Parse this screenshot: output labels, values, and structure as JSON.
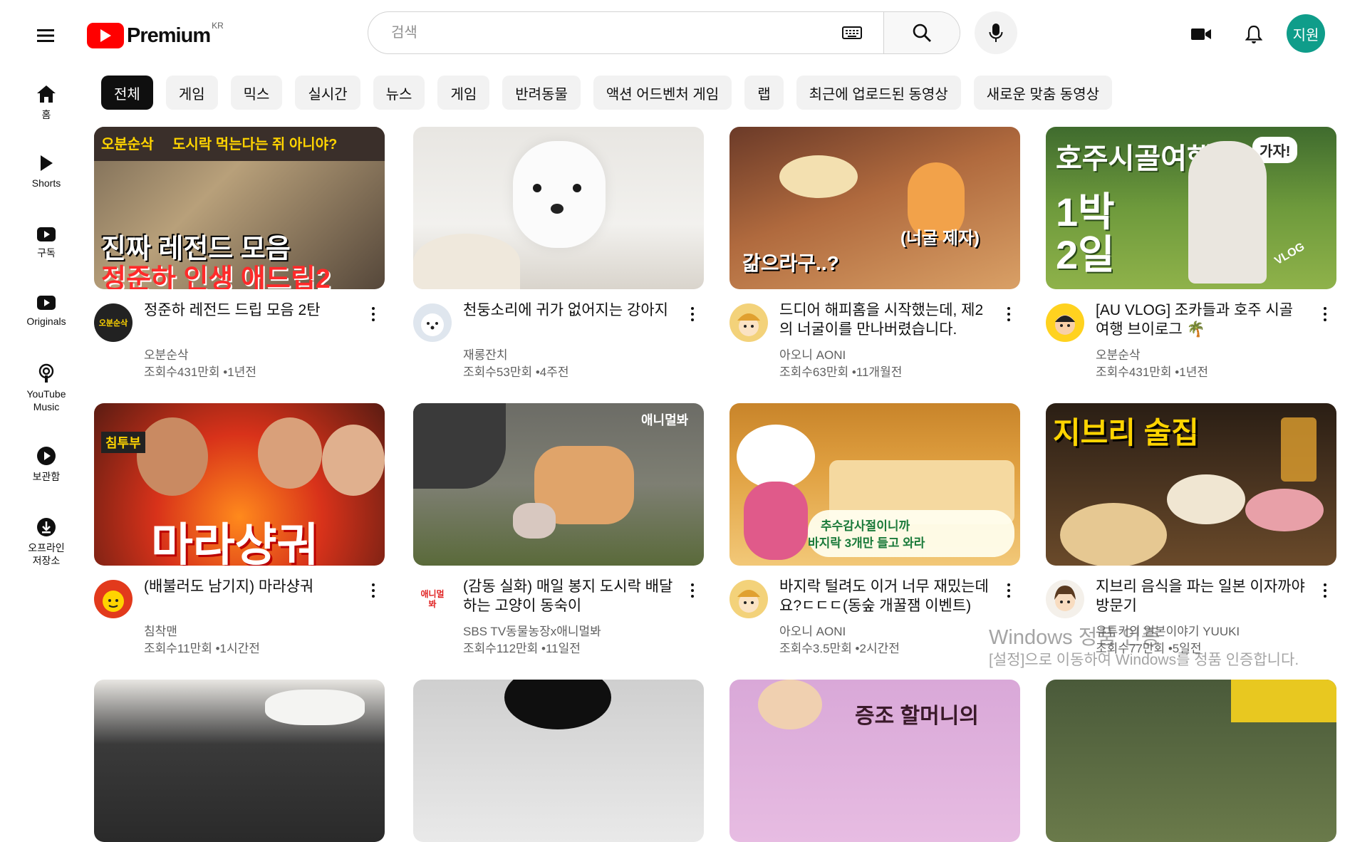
{
  "header": {
    "logo_text": "Premium",
    "logo_region": "KR",
    "search_placeholder": "검색",
    "user_initials": "지원"
  },
  "sidebar": {
    "items": [
      {
        "label": "홈",
        "icon": "home-icon"
      },
      {
        "label": "Shorts",
        "icon": "shorts-icon"
      },
      {
        "label": "구독",
        "icon": "subscriptions-icon"
      },
      {
        "label": "Originals",
        "icon": "originals-icon"
      },
      {
        "label": "YouTube\nMusic",
        "icon": "music-icon"
      },
      {
        "label": "보관함",
        "icon": "library-icon"
      },
      {
        "label": "오프라인\n저장소",
        "icon": "download-icon"
      }
    ]
  },
  "chips": [
    "전체",
    "게임",
    "믹스",
    "실시간",
    "뉴스",
    "게임",
    "반려동물",
    "액션 어드벤처 게임",
    "랩",
    "최근에 업로드된 동영상",
    "새로운 맞춤 동영상"
  ],
  "videos": [
    {
      "title": "정준하 레전드 드립 모음 2탄",
      "channel": "오분순삭",
      "stats": "조회수431만회 •1년전",
      "thumb_text": [
        "오분순삭",
        "도시락 먹는다는 쥐 아니야?",
        "진짜 레전드 모음",
        "정준하 인생 애드립2"
      ],
      "avatar_text": "오분순삭"
    },
    {
      "title": "천둥소리에 귀가 없어지는 강아지",
      "channel": "재롱잔치",
      "stats": "조회수53만회 •4주전",
      "thumb_text": [],
      "avatar_text": ""
    },
    {
      "title": "드디어 해피홈을 시작했는데, 제2의 너굴이를 만나버렸습니다.",
      "channel": "아오니 AONI",
      "stats": "조회수63만회 •11개월전",
      "thumb_text": [
        "갊으라구..?",
        "(너굴 제자)"
      ],
      "avatar_text": ""
    },
    {
      "title": "[AU VLOG] 조카들과 호주 시골 여행 브이로그 🌴",
      "channel": "오분순삭",
      "stats": "조회수431만회 •1년전",
      "thumb_text": [
        "호주시골여행",
        "1박2일",
        "가자!",
        "VLOG"
      ],
      "avatar_text": ""
    },
    {
      "title": "(배불러도 남기지) 마라샹궈",
      "channel": "침착맨",
      "stats": "조회수11만회 •1시간전",
      "thumb_text": [
        "침투부",
        "마라샹궈"
      ],
      "avatar_text": ""
    },
    {
      "title": "(감동 실화) 매일 봉지 도시락 배달하는 고양이 동숙이",
      "channel": "SBS TV동물농장x애니멀봐",
      "stats": "조회수112만회 •11일전",
      "thumb_text": [
        "애니멀봐"
      ],
      "avatar_text": "애니멀봐"
    },
    {
      "title": "바지락 털려도 이거 너무 재밌는데요?ㄷㄷㄷ(동숲 개꿀잼 이벤트)",
      "channel": "아오니 AONI",
      "stats": "조회수3.5만회 •2시간전",
      "thumb_text": [
        "추수감사절이니까",
        "바지락 3개만 들고 와라"
      ],
      "avatar_text": ""
    },
    {
      "title": "지브리 음식을 파는 일본 이자까야 방문기",
      "channel": "유튜키의 일본이야기 YUUKI",
      "stats": "조회수77만회 •5일전",
      "thumb_text": [
        "지브리 술집"
      ],
      "avatar_text": ""
    },
    {
      "title": "",
      "channel": "",
      "stats": "",
      "thumb_text": [],
      "avatar_text": ""
    },
    {
      "title": "",
      "channel": "",
      "stats": "",
      "thumb_text": [],
      "avatar_text": ""
    },
    {
      "title": "",
      "channel": "",
      "stats": "",
      "thumb_text": [
        "증조 할머니의"
      ],
      "avatar_text": ""
    },
    {
      "title": "",
      "channel": "",
      "stats": "",
      "thumb_text": [],
      "avatar_text": ""
    }
  ],
  "watermark": {
    "line1": "Windows 정품 인증",
    "line2": "[설정]으로 이동하여 Windows를 정품 인증합니다."
  },
  "colors": {
    "brand_red": "#ff0000",
    "chip_bg": "#f2f2f2",
    "chip_active": "#0f0f0f",
    "avatar_bg": "#0f9d8a"
  }
}
